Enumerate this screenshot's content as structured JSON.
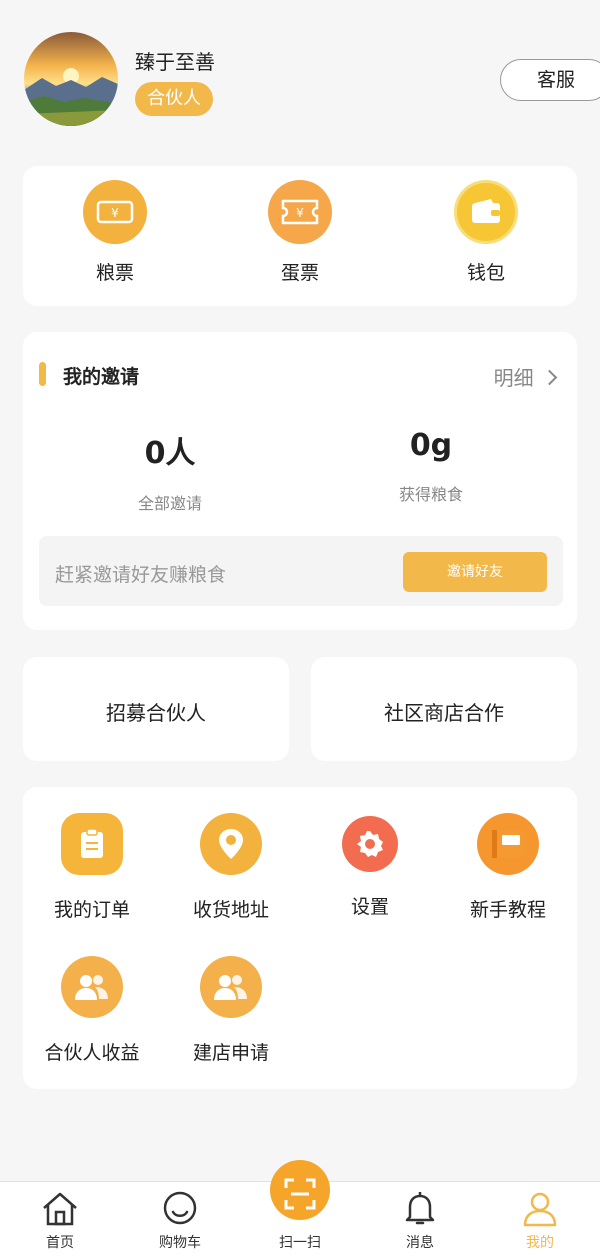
{
  "profile": {
    "name": "臻于至善",
    "badge": "合伙人",
    "service_label": "客服"
  },
  "quick": [
    {
      "label": "粮票",
      "icon": "grain-ticket-icon",
      "color": "#f2b23d"
    },
    {
      "label": "蛋票",
      "icon": "egg-ticket-icon",
      "color": "#f5a74a"
    },
    {
      "label": "钱包",
      "icon": "wallet-icon",
      "color": "#f6c634"
    }
  ],
  "invite": {
    "title": "我的邀请",
    "detail": "明细",
    "stats": [
      {
        "value": "0人",
        "caption": "全部邀请"
      },
      {
        "value": "0g",
        "caption": "获得粮食"
      }
    ],
    "prompt": "赶紧邀请好友赚粮食",
    "button": "邀请好友"
  },
  "partners": {
    "recruit": "招募合伙人",
    "shop_coop": "社区商店合作"
  },
  "menu": [
    {
      "label": "我的订单",
      "icon": "order-icon",
      "color": "#f5b43a"
    },
    {
      "label": "收货地址",
      "icon": "location-icon",
      "color": "#f2b23d"
    },
    {
      "label": "设置",
      "icon": "gear-icon",
      "color": "#f26d4f"
    },
    {
      "label": "新手教程",
      "icon": "book-icon",
      "color": "#f5962e"
    },
    {
      "label": "合伙人收益",
      "icon": "people-icon",
      "color": "#f4b04a"
    },
    {
      "label": "建店申请",
      "icon": "people-icon",
      "color": "#f4b04a"
    }
  ],
  "nav": [
    {
      "label": "首页",
      "icon": "home-icon"
    },
    {
      "label": "购物车",
      "icon": "cart-icon"
    },
    {
      "label": "扫一扫",
      "icon": "scan-icon"
    },
    {
      "label": "消息",
      "icon": "bell-icon"
    },
    {
      "label": "我的",
      "icon": "user-icon"
    }
  ],
  "colors": {
    "accent": "#f2b84a",
    "scan": "#f6a52b"
  }
}
